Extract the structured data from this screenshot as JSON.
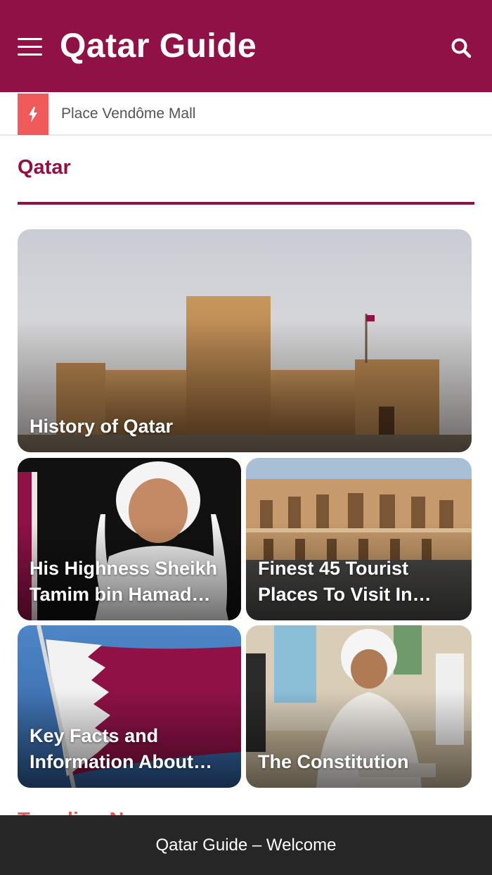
{
  "header": {
    "site_title": "Qatar Guide",
    "menu_icon": "hamburger-menu-icon",
    "search_icon": "search-icon",
    "background": "#8f1146"
  },
  "ticker": {
    "icon": "lightning-bolt-icon",
    "text": "Place Vendôme Mall",
    "badge_color": "#f05a5a"
  },
  "section": {
    "title": "Qatar"
  },
  "cards": [
    {
      "title": "History of Qatar",
      "lines": [
        "History of Qatar"
      ]
    },
    {
      "title": "His Highness Sheikh Tamim bin Hamad…",
      "lines": [
        "His Highness Sheikh",
        "Tamim bin Hamad…"
      ]
    },
    {
      "title": "Finest 45 Tourist Places To Visit In…",
      "lines": [
        "Finest 45 Tourist",
        "Places To Visit In…"
      ]
    },
    {
      "title": "Key Facts and Information About…",
      "lines": [
        "Key Facts and",
        "Information About…"
      ]
    },
    {
      "title": "The Constitution",
      "lines": [
        "The Constitution"
      ]
    }
  ],
  "next_section_peek": "Trending News",
  "footer": {
    "text": "Qatar Guide – Welcome"
  }
}
